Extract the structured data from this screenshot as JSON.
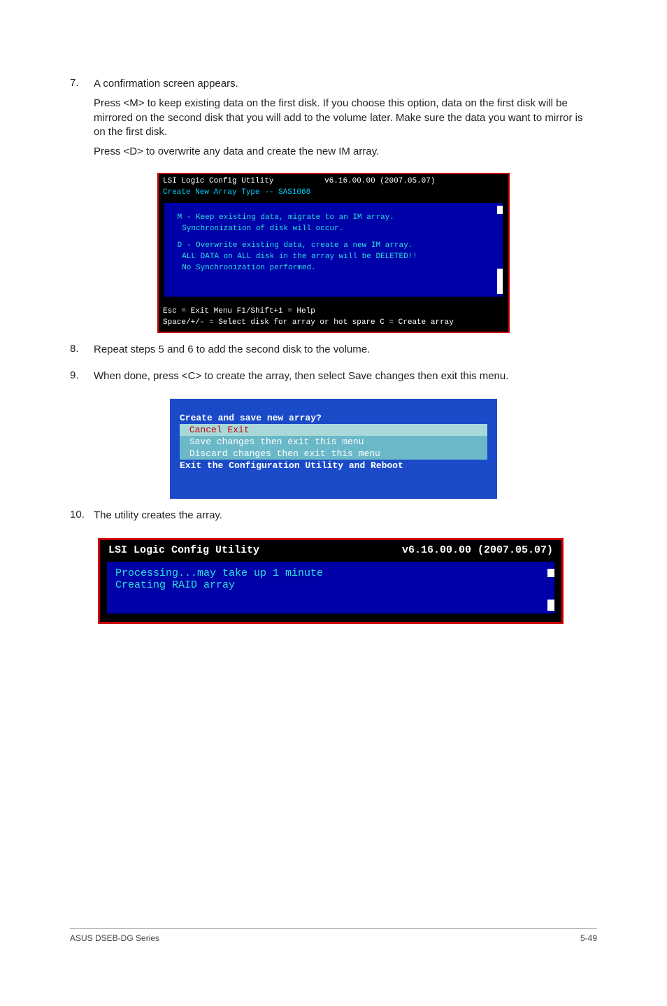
{
  "step7": {
    "num": "7.",
    "title": "A confirmation screen appears.",
    "p1": "Press <M> to keep existing data on the first disk. If you choose this option, data on the first disk will be mirrored on the second disk that you will add to the volume later. Make sure the data you want to mirror is on the first disk.",
    "p2": " Press <D> to overwrite any data and create the new IM array."
  },
  "term1": {
    "title_left": "LSI Logic Config Utility",
    "title_right": "v6.16.00.00 (2007.05.07)",
    "subtitle": "Create New Array Type -- SAS1068",
    "optM": {
      "k": "M",
      "l1": " - Keep existing data, migrate to an IM array.",
      "l2": "    Synchronization of disk will occur."
    },
    "optD": {
      "k": "D",
      "l1": " - Overwrite existing data, create a new IM array.",
      "l2": "    ALL DATA on ALL disk in the array will be DELETED!!",
      "l3": "    No Synchronization performed."
    },
    "foot1": "Esc = Exit Menu     F1/Shift+1 = Help",
    "foot2": "Space/+/- = Select disk for array or hot spare   C = Create array"
  },
  "step8": {
    "num": "8.",
    "text": "Repeat steps 5 and 6 to add the second disk to the volume."
  },
  "step9": {
    "num": "9.",
    "text": "When done, press <C> to create the array, then select Save changes then exit this menu."
  },
  "menu": {
    "title": "Create and save new array?",
    "items": [
      "Cancel Exit",
      "Save changes then exit this menu",
      "Discard changes then exit this menu"
    ],
    "exit": "Exit the Configuration Utility and Reboot"
  },
  "step10": {
    "num": "10.",
    "text": "The utility creates the array."
  },
  "proc": {
    "title_left": "LSI Logic Config Utility",
    "title_right": "v6.16.00.00 (2007.05.07)",
    "l1": "Processing...may take up 1 minute",
    "l2": "Creating RAID array"
  },
  "footer": {
    "left": "ASUS DSEB-DG Series",
    "right": "5-49"
  }
}
